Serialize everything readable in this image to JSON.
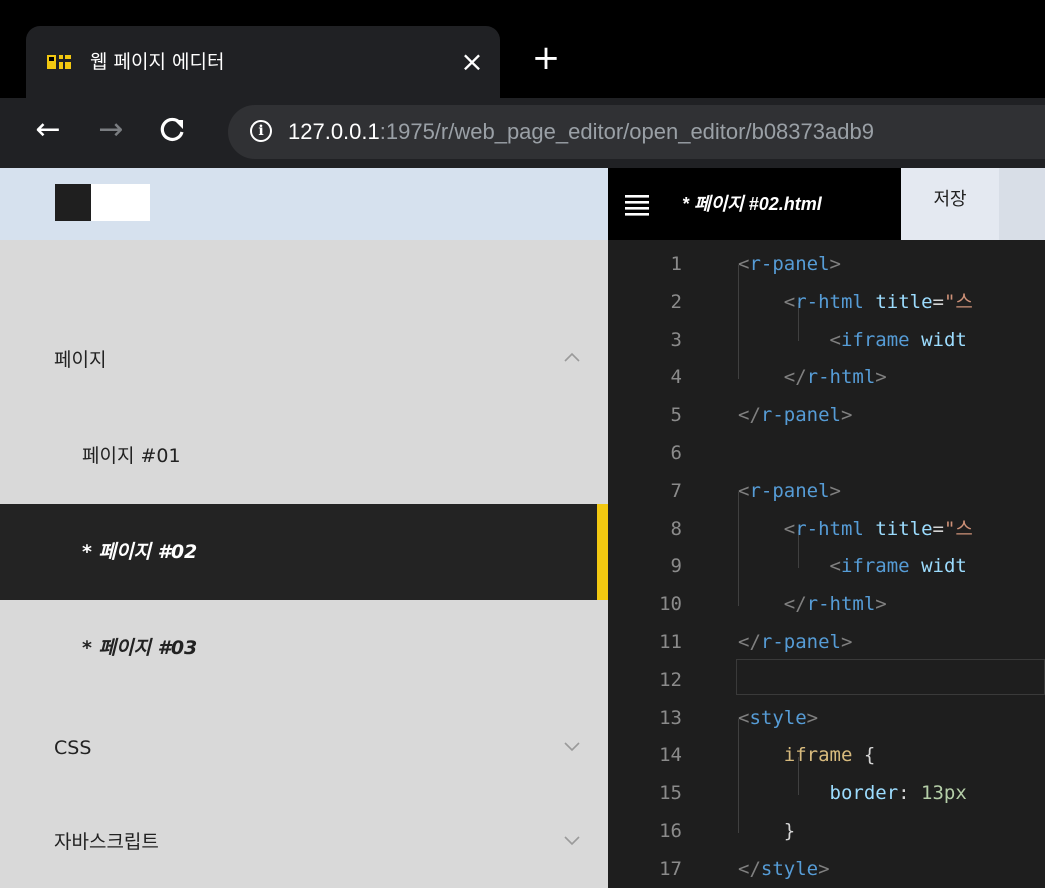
{
  "browser": {
    "tab_title": "웹 페이지 에디터",
    "tab_close": "×",
    "new_tab": "+",
    "back": "←",
    "forward": "→",
    "reload": "C",
    "info": "i",
    "url_host": "127.0.0.1",
    "url_rest": ":1975/r/web_page_editor/open_editor/b08373adb9"
  },
  "sidebar": {
    "sections": [
      {
        "label": "페이지",
        "expanded": true
      },
      {
        "label": "CSS",
        "expanded": false
      },
      {
        "label": "자바스크립트",
        "expanded": false
      }
    ],
    "pages": [
      {
        "label": "페이지 #01",
        "modified": false,
        "active": false
      },
      {
        "label": "* 페이지 #02",
        "modified": true,
        "active": true
      },
      {
        "label": "* 페이지 #03",
        "modified": true,
        "active": false
      }
    ],
    "accent_color": "#f2c811"
  },
  "editor": {
    "file_name": "* 페이지 #02.html",
    "save_label": "저장",
    "current_line": 12,
    "lines": [
      {
        "n": "1",
        "tokens": [
          [
            "t-br",
            "<"
          ],
          [
            "t-tag",
            "r-panel"
          ],
          [
            "t-br",
            ">"
          ]
        ]
      },
      {
        "n": "2",
        "tokens": [
          [
            "t-punc",
            "    "
          ],
          [
            "t-br",
            "<"
          ],
          [
            "t-tag",
            "r-html"
          ],
          [
            "t-punc",
            " "
          ],
          [
            "t-attr",
            "title"
          ],
          [
            "t-punc",
            "="
          ],
          [
            "t-str",
            "\"스"
          ]
        ]
      },
      {
        "n": "3",
        "tokens": [
          [
            "t-punc",
            "        "
          ],
          [
            "t-br",
            "<"
          ],
          [
            "t-tag",
            "iframe"
          ],
          [
            "t-punc",
            " "
          ],
          [
            "t-attr",
            "widt"
          ]
        ]
      },
      {
        "n": "4",
        "tokens": [
          [
            "t-punc",
            "    "
          ],
          [
            "t-br",
            "</"
          ],
          [
            "t-tag",
            "r-html"
          ],
          [
            "t-br",
            ">"
          ]
        ]
      },
      {
        "n": "5",
        "tokens": [
          [
            "t-br",
            "</"
          ],
          [
            "t-tag",
            "r-panel"
          ],
          [
            "t-br",
            ">"
          ]
        ]
      },
      {
        "n": "6",
        "tokens": []
      },
      {
        "n": "7",
        "tokens": [
          [
            "t-br",
            "<"
          ],
          [
            "t-tag",
            "r-panel"
          ],
          [
            "t-br",
            ">"
          ]
        ]
      },
      {
        "n": "8",
        "tokens": [
          [
            "t-punc",
            "    "
          ],
          [
            "t-br",
            "<"
          ],
          [
            "t-tag",
            "r-html"
          ],
          [
            "t-punc",
            " "
          ],
          [
            "t-attr",
            "title"
          ],
          [
            "t-punc",
            "="
          ],
          [
            "t-str",
            "\"스"
          ]
        ]
      },
      {
        "n": "9",
        "tokens": [
          [
            "t-punc",
            "        "
          ],
          [
            "t-br",
            "<"
          ],
          [
            "t-tag",
            "iframe"
          ],
          [
            "t-punc",
            " "
          ],
          [
            "t-attr",
            "widt"
          ]
        ]
      },
      {
        "n": "10",
        "tokens": [
          [
            "t-punc",
            "    "
          ],
          [
            "t-br",
            "</"
          ],
          [
            "t-tag",
            "r-html"
          ],
          [
            "t-br",
            ">"
          ]
        ]
      },
      {
        "n": "11",
        "tokens": [
          [
            "t-br",
            "</"
          ],
          [
            "t-tag",
            "r-panel"
          ],
          [
            "t-br",
            ">"
          ]
        ]
      },
      {
        "n": "12",
        "tokens": []
      },
      {
        "n": "13",
        "tokens": [
          [
            "t-br",
            "<"
          ],
          [
            "t-tag",
            "style"
          ],
          [
            "t-br",
            ">"
          ]
        ]
      },
      {
        "n": "14",
        "tokens": [
          [
            "t-punc",
            "    "
          ],
          [
            "t-sel",
            "iframe"
          ],
          [
            "t-punc",
            " {"
          ]
        ]
      },
      {
        "n": "15",
        "tokens": [
          [
            "t-punc",
            "        "
          ],
          [
            "t-prop",
            "border"
          ],
          [
            "t-punc",
            ": "
          ],
          [
            "t-val",
            "13px"
          ]
        ]
      },
      {
        "n": "16",
        "tokens": [
          [
            "t-punc",
            "    }"
          ]
        ]
      },
      {
        "n": "17",
        "tokens": [
          [
            "t-br",
            "</"
          ],
          [
            "t-tag",
            "style"
          ],
          [
            "t-br",
            ">"
          ]
        ]
      }
    ]
  }
}
